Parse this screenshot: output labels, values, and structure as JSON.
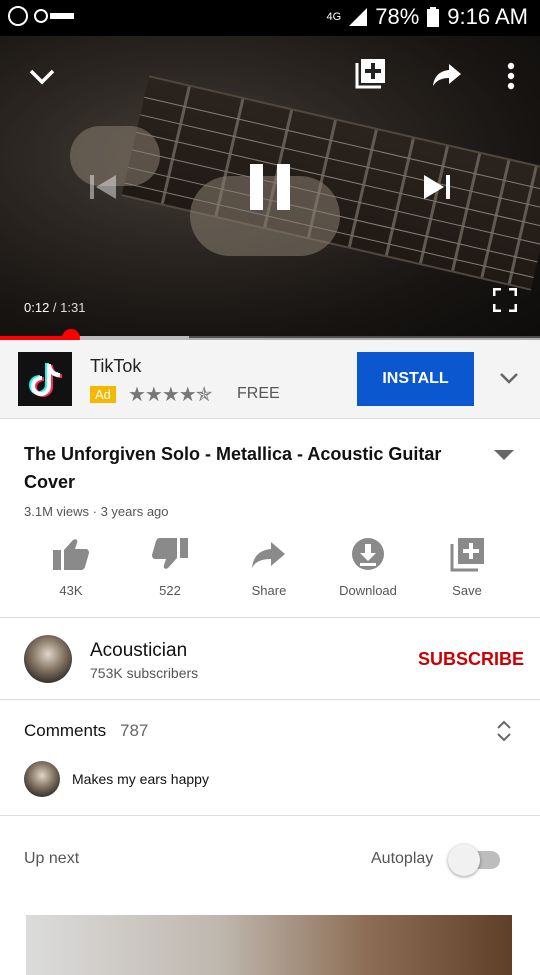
{
  "status_bar": {
    "network": "4G",
    "battery": "78%",
    "time": "9:16 AM"
  },
  "player": {
    "current_time": "0:12",
    "separator": " / ",
    "duration": "1:31",
    "progress_fraction": 0.132,
    "buffer_fraction": 0.35
  },
  "ad": {
    "app_name": "TikTok",
    "badge": "Ad",
    "rating_stars": "★★★★✯",
    "price": "FREE",
    "install_label": "INSTALL"
  },
  "video": {
    "title": "The Unforgiven Solo - Metallica - Acoustic Guitar Cover",
    "meta": "3.1M views · 3 years ago"
  },
  "actions": [
    {
      "label": "43K",
      "icon": "thumbs-up-icon"
    },
    {
      "label": "522",
      "icon": "thumbs-down-icon"
    },
    {
      "label": "Share",
      "icon": "share-icon"
    },
    {
      "label": "Download",
      "icon": "download-icon"
    },
    {
      "label": "Save",
      "icon": "add-to-playlist-icon"
    }
  ],
  "channel": {
    "name": "Acoustician",
    "subscribers": "753K subscribers",
    "subscribe_label": "SUBSCRIBE"
  },
  "comments": {
    "label": "Comments",
    "count": "787",
    "top_comment": "Makes my ears happy"
  },
  "up_next": {
    "label": "Up next",
    "autoplay_label": "Autoplay",
    "autoplay_on": false
  },
  "colors": {
    "accent_red": "#ff0000",
    "install_blue": "#0b57d0",
    "subscribe_red": "#cc0000",
    "ad_badge": "#f5b800"
  }
}
